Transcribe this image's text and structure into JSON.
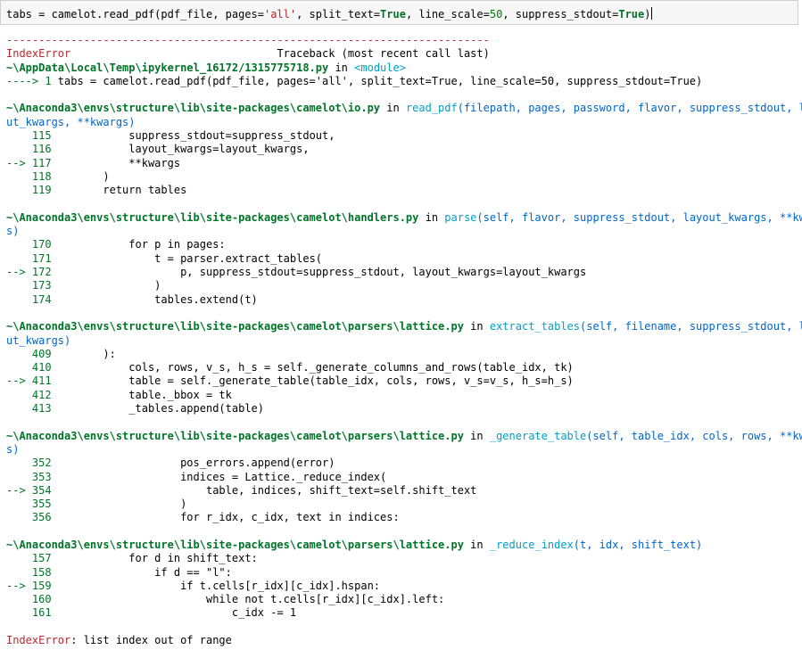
{
  "input_cell": {
    "code_prefix": "tabs = camelot.read_pdf(pdf_file, pages=",
    "code_str": "'all'",
    "code_mid": ", split_text=",
    "code_true1": "True",
    "code_mid2": ", line_scale=",
    "code_num": "50",
    "code_mid3": ", suppress_stdout=",
    "code_true2": "True",
    "code_end": ")"
  },
  "traceback": {
    "dashes": "---------------------------------------------------------------------------",
    "error_name": "IndexError",
    "header_right": "                                Traceback (most recent call last)",
    "frame0": {
      "path": "~\\AppData\\Local\\Temp\\ipykernel_16172/1315775718.py",
      "in": " in ",
      "module": "<module>",
      "arrow": "----> 1 ",
      "code": "tabs = camelot.read_pdf(pdf_file, pages='all', split_text=True, line_scale=50, suppress_stdout=True)"
    },
    "frame1": {
      "path": "~\\Anaconda3\\envs\\structure\\lib\\site-packages\\camelot\\io.py",
      "in": " in ",
      "func": "read_pdf",
      "args_line1": "(filepath, pages, password, flavor, suppress_stdout, layo",
      "args_line2": "ut_kwargs, **kwargs)",
      "lines": [
        {
          "no": "    115",
          "code": "            suppress_stdout=suppress_stdout,"
        },
        {
          "no": "    116",
          "code": "            layout_kwargs=layout_kwargs,"
        },
        {
          "no": "--> 117",
          "code": "            **kwargs"
        },
        {
          "no": "    118",
          "code": "        )"
        },
        {
          "no": "    119",
          "code": "        return tables"
        }
      ]
    },
    "frame2": {
      "path": "~\\Anaconda3\\envs\\structure\\lib\\site-packages\\camelot\\handlers.py",
      "in": " in ",
      "func": "parse",
      "args_line1": "(self, flavor, suppress_stdout, layout_kwargs, **kwarg",
      "args_line2": "s)",
      "lines": [
        {
          "no": "    170",
          "code": "            for p in pages:"
        },
        {
          "no": "    171",
          "code": "                t = parser.extract_tables("
        },
        {
          "no": "--> 172",
          "code": "                    p, suppress_stdout=suppress_stdout, layout_kwargs=layout_kwargs"
        },
        {
          "no": "    173",
          "code": "                )"
        },
        {
          "no": "    174",
          "code": "                tables.extend(t)"
        }
      ]
    },
    "frame3": {
      "path": "~\\Anaconda3\\envs\\structure\\lib\\site-packages\\camelot\\parsers\\lattice.py",
      "in": " in ",
      "func": "extract_tables",
      "args_line1": "(self, filename, suppress_stdout, layo",
      "args_line2": "ut_kwargs)",
      "lines": [
        {
          "no": "    409",
          "code": "        ):"
        },
        {
          "no": "    410",
          "code": "            cols, rows, v_s, h_s = self._generate_columns_and_rows(table_idx, tk)"
        },
        {
          "no": "--> 411",
          "code": "            table = self._generate_table(table_idx, cols, rows, v_s=v_s, h_s=h_s)"
        },
        {
          "no": "    412",
          "code": "            table._bbox = tk"
        },
        {
          "no": "    413",
          "code": "            _tables.append(table)"
        }
      ]
    },
    "frame4": {
      "path": "~\\Anaconda3\\envs\\structure\\lib\\site-packages\\camelot\\parsers\\lattice.py",
      "in": " in ",
      "func": "_generate_table",
      "args_line1": "(self, table_idx, cols, rows, **kwarg",
      "args_line2": "s)",
      "lines": [
        {
          "no": "    352",
          "code": "                    pos_errors.append(error)"
        },
        {
          "no": "    353",
          "code": "                    indices = Lattice._reduce_index("
        },
        {
          "no": "--> 354",
          "code": "                        table, indices, shift_text=self.shift_text"
        },
        {
          "no": "    355",
          "code": "                    )"
        },
        {
          "no": "    356",
          "code": "                    for r_idx, c_idx, text in indices:"
        }
      ]
    },
    "frame5": {
      "path": "~\\Anaconda3\\envs\\structure\\lib\\site-packages\\camelot\\parsers\\lattice.py",
      "in": " in ",
      "func": "_reduce_index",
      "args_line1": "(t, idx, shift_text)",
      "lines": [
        {
          "no": "    157",
          "code": "            for d in shift_text:"
        },
        {
          "no": "    158",
          "code": "                if d == \"l\":"
        },
        {
          "no": "--> 159",
          "code": "                    if t.cells[r_idx][c_idx].hspan:"
        },
        {
          "no": "    160",
          "code": "                        while not t.cells[r_idx][c_idx].left:"
        },
        {
          "no": "    161",
          "code": "                            c_idx -= 1"
        }
      ]
    },
    "final_error_name": "IndexError",
    "final_error_msg": ": list index out of range"
  }
}
